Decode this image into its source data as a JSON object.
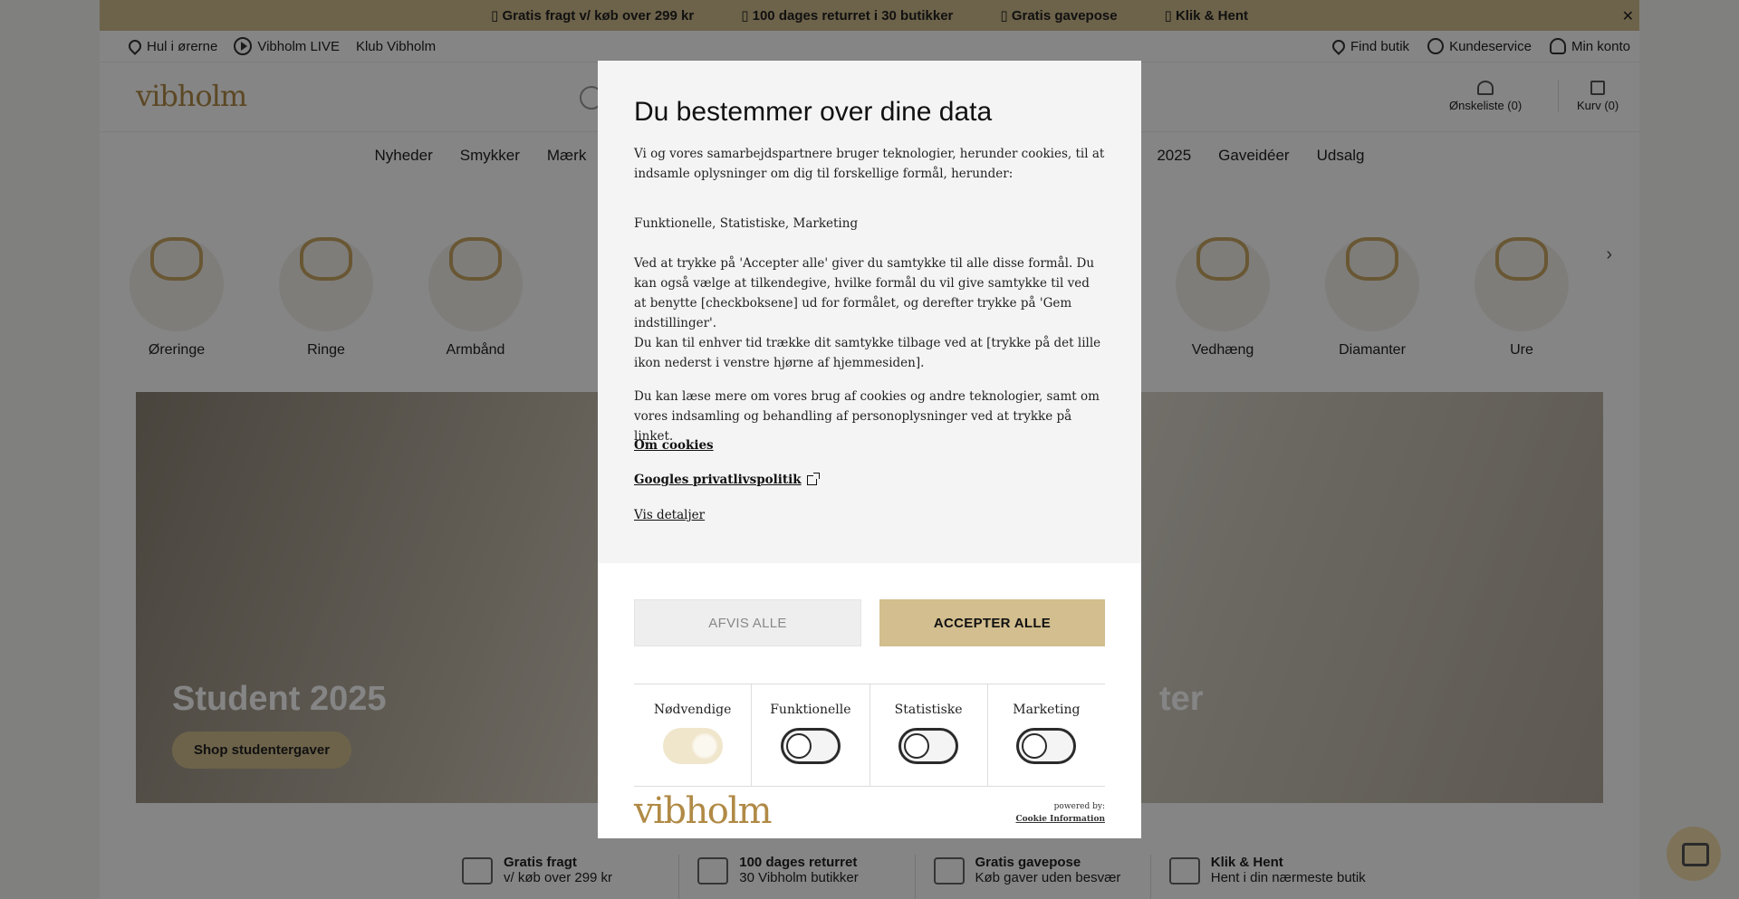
{
  "topbar": {
    "items": [
      "▯ Gratis fragt v/ køb over 299 kr",
      "▯ 100 dages returret i 30 butikker",
      "▯ Gratis gavepose",
      "▯ Klik & Hent"
    ],
    "close": "✕"
  },
  "utilbar": {
    "left": [
      "Hul i ørerne",
      "Vibholm LIVE",
      "Klub Vibholm"
    ],
    "right": [
      "Find butik",
      "Kundeservice",
      "Min konto"
    ]
  },
  "header": {
    "logo": "vibholm",
    "wishlist": "Ønskeliste (0)",
    "cart": "Kurv (0)"
  },
  "nav": [
    "Nyheder",
    "Smykker",
    "Mærk",
    "2025",
    "Gaveidéer",
    "Udsalg"
  ],
  "categories": [
    "Øreringe",
    "Ringe",
    "Armbånd",
    "r",
    "Vedhæng",
    "Diamanter",
    "Ure"
  ],
  "hero": {
    "left_title": "Student 2025",
    "left_button": "Shop studentergaver",
    "right_title": "ter"
  },
  "usps": [
    {
      "title": "Gratis fragt",
      "sub": "v/ køb over 299 kr"
    },
    {
      "title": "100 dages returret",
      "sub": "30 Vibholm butikker"
    },
    {
      "title": "Gratis gavepose",
      "sub": "Køb gaver uden besvær"
    },
    {
      "title": "Klik & Hent",
      "sub": "Hent i din nærmeste butik"
    }
  ],
  "consent": {
    "title": "Du bestemmer over dine data",
    "intro": "Vi og vores samarbejdspartnere bruger teknologier, herunder cookies, til at indsamle oplysninger om dig til forskellige formål, herunder:",
    "purposes": "Funktionelle, Statistiske, Marketing",
    "accept_info": "Ved at trykke på 'Accepter alle' giver du samtykke til alle disse formål. Du kan også vælge at tilkendegive, hvilke formål du vil give samtykke til ved at benytte [checkboksene] ud for formålet, og derefter trykke på 'Gem indstillinger'.",
    "withdraw_info": "Du kan til enhver tid trække dit samtykke tilbage ved at [trykke på det lille ikon nederst i venstre hjørne af hjemmesiden].",
    "more_info": "Du kan læse mere om vores brug af cookies og andre teknologier, samt om vores indsamling og behandling af personoplysninger ved at trykke på linket.",
    "link_cookies": "Om cookies",
    "link_google": "Googles privatlivspolitik",
    "link_details": "Vis detaljer",
    "reject_label": "AFVIS ALLE",
    "accept_label": "ACCEPTER ALLE",
    "toggles": [
      {
        "label": "Nødvendige",
        "checked": true
      },
      {
        "label": "Funktionelle",
        "checked": false
      },
      {
        "label": "Statistiske",
        "checked": false
      },
      {
        "label": "Marketing",
        "checked": false
      }
    ],
    "footer_logo": "vibholm",
    "powered_by": "powered by:",
    "powered_brand": "Cookie Information"
  },
  "colors": {
    "accent": "#d2be8e",
    "brand_gold": "#b08a46"
  }
}
